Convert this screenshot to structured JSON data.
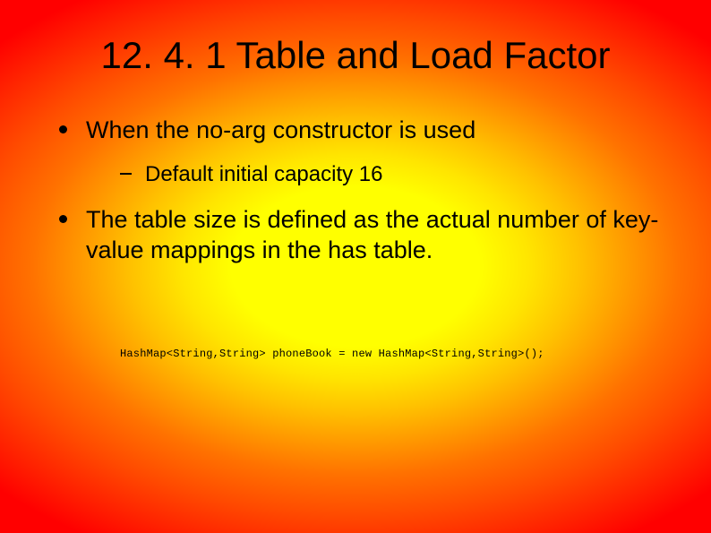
{
  "slide": {
    "title": "12. 4. 1 Table and Load Factor",
    "bullets": [
      {
        "text": "When the no-arg constructor is used",
        "sub": [
          "Default initial capacity 16"
        ]
      },
      {
        "text": "The table size is defined as the actual number of key-value mappings in the has table.",
        "sub": []
      }
    ],
    "code": "HashMap<String,String> phoneBook = new HashMap<String,String>();"
  }
}
